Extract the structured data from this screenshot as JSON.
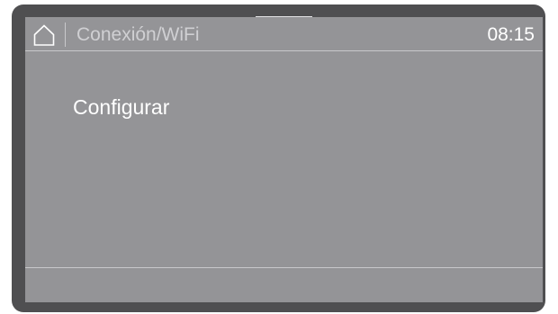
{
  "header": {
    "home_icon": "house-icon",
    "title": "Conexión/WiFi",
    "clock": "08:15"
  },
  "menu": {
    "items": [
      {
        "label": "Configurar"
      }
    ]
  }
}
